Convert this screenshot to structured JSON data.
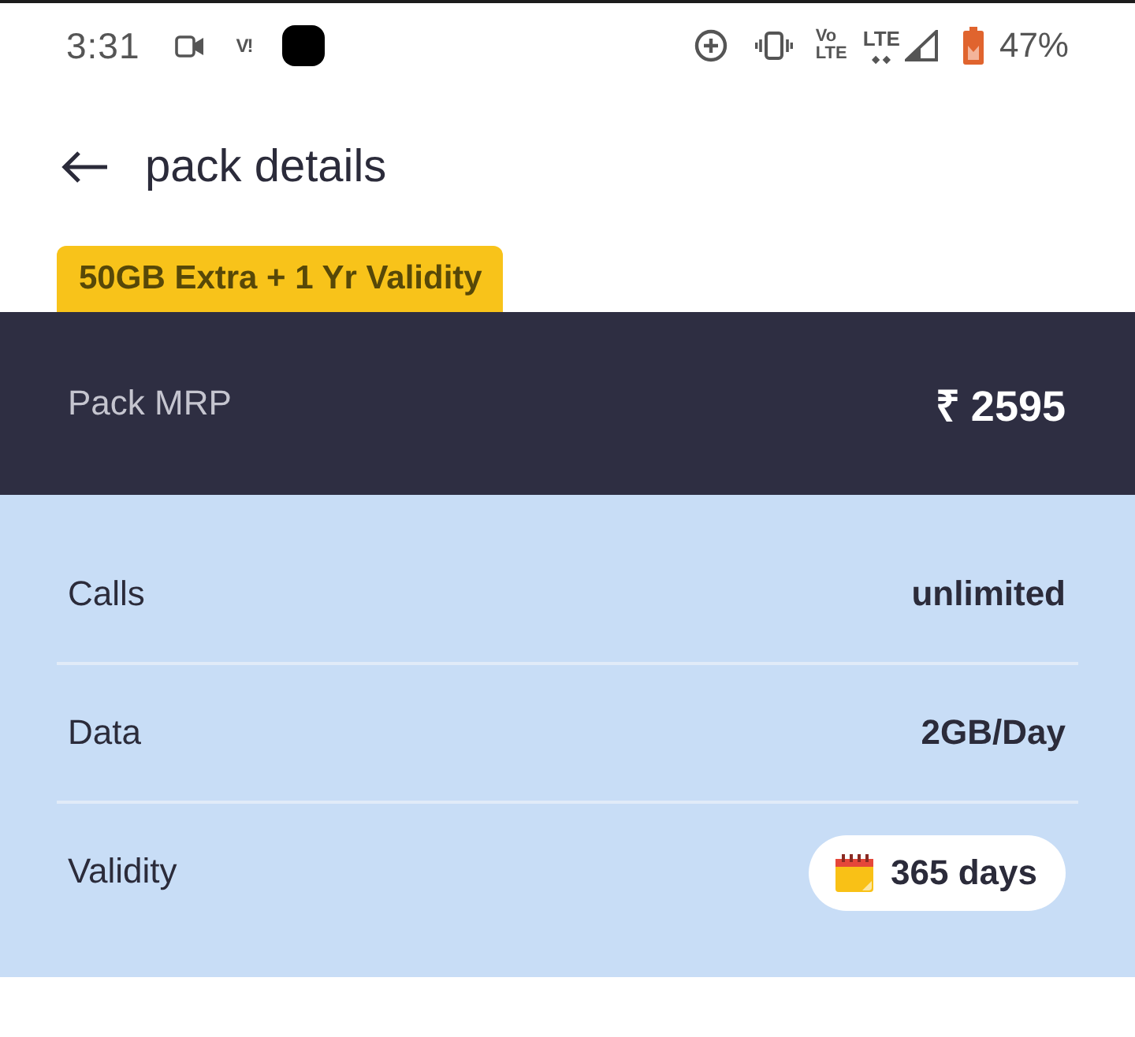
{
  "status_bar": {
    "time": "3:31",
    "carrier": "V!",
    "volte": [
      "Vo",
      "LTE"
    ],
    "network": "LTE",
    "battery": "47%"
  },
  "header": {
    "title": "pack details"
  },
  "badge": "50GB Extra + 1 Yr Validity",
  "price": {
    "label": "Pack MRP",
    "value": "₹ 2595"
  },
  "benefits": [
    {
      "kind": "text",
      "label": "Calls",
      "value": "unlimited"
    },
    {
      "kind": "text",
      "label": "Data",
      "value": "2GB/Day"
    },
    {
      "kind": "chip",
      "label": "Validity",
      "value": "365 days"
    }
  ]
}
